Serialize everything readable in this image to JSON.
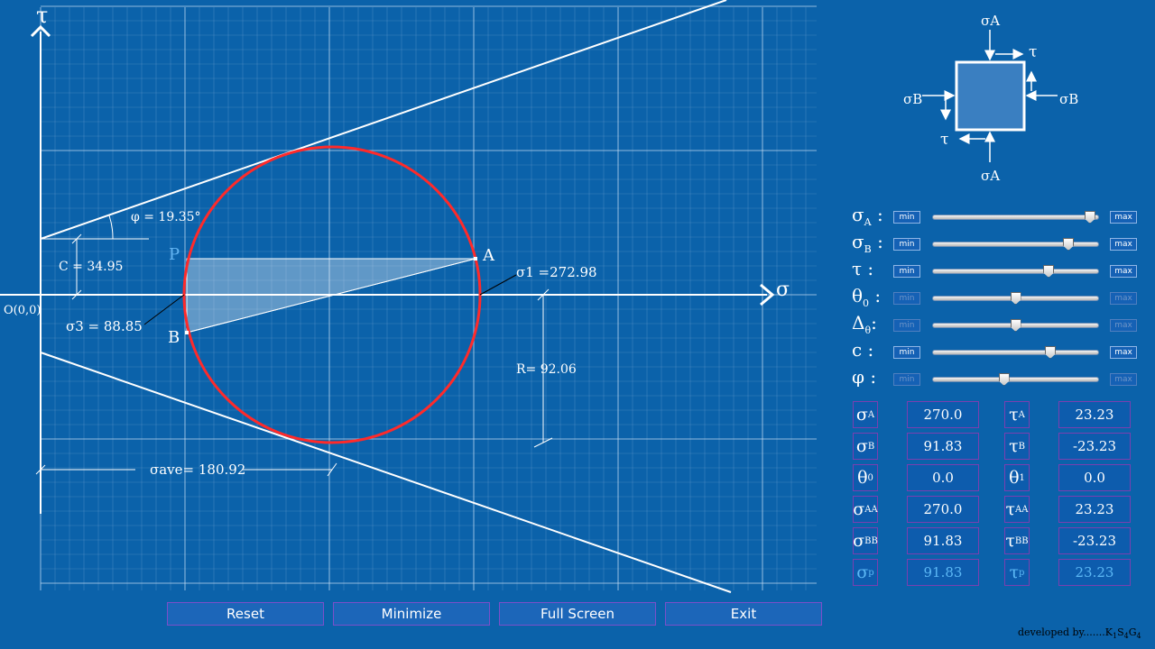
{
  "plot": {
    "axis_sigma": "σ",
    "axis_tau": "τ",
    "origin": "O(0,0)",
    "phi_label": "φ = 19.35°",
    "c_label": "C = 34.95",
    "sigma1_label": "σ1 =272.98",
    "sigma3_label": "σ3 = 88.85",
    "R_label": "R= 92.06",
    "sigma_ave_label": "σave= 180.92",
    "point_P": "P",
    "point_A": "A",
    "point_B": "B",
    "colors": {
      "circle": "#ff2a2a",
      "grid": "#3d86c6",
      "pole": "#62b4f2"
    }
  },
  "element": {
    "top": "σA",
    "bottom": "σA",
    "left": "σB",
    "right": "σB",
    "tau_top": "τ",
    "tau_bottom": "τ"
  },
  "controls": [
    {
      "label": "σA :",
      "min": "min",
      "max": "max",
      "value": 0.95,
      "enabled": true
    },
    {
      "label": "σB :",
      "min": "min",
      "max": "max",
      "value": 0.82,
      "enabled": true
    },
    {
      "label": "τ :",
      "min": "min",
      "max": "max",
      "value": 0.7,
      "enabled": true
    },
    {
      "label": "θ0 :",
      "min": "min",
      "max": "max",
      "value": 0.5,
      "enabled": false
    },
    {
      "label": "Δθ:",
      "min": "min",
      "max": "max",
      "value": 0.5,
      "enabled": false
    },
    {
      "label": "c :",
      "min": "min",
      "max": "max",
      "value": 0.71,
      "enabled": true
    },
    {
      "label": "φ :",
      "min": "min",
      "max": "max",
      "value": 0.43,
      "enabled": false
    }
  ],
  "values": [
    {
      "sym1": "σA",
      "val1": "270.0",
      "sym2": "τA",
      "val2": "23.23"
    },
    {
      "sym1": "σB",
      "val1": "91.83",
      "sym2": "τB",
      "val2": "-23.23"
    },
    {
      "sym1": "θ0",
      "val1": "0.0",
      "sym2": "θ1",
      "val2": "0.0"
    },
    {
      "sym1": "σAA",
      "val1": "270.0",
      "sym2": "τAA",
      "val2": "23.23"
    },
    {
      "sym1": "σBB",
      "val1": "91.83",
      "sym2": "τBB",
      "val2": "-23.23"
    },
    {
      "sym1": "σp",
      "val1": "91.83",
      "sym2": "τp",
      "val2": "23.23"
    }
  ],
  "buttons": {
    "reset": "Reset",
    "minimize": "Minimize",
    "fullscreen": "Full Screen",
    "exit": "Exit"
  },
  "credit": "developed by.......K1S4G4"
}
